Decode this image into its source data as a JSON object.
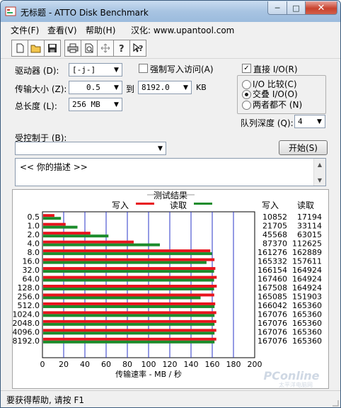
{
  "window": {
    "title": "无标题 - ATTO Disk Benchmark",
    "min": "─",
    "max": "□",
    "close": "✕"
  },
  "menu": [
    "文件(F)",
    "查看(V)",
    "帮助(H)",
    "汉化: www.upantool.com"
  ],
  "toolbar_icons": [
    "new-icon",
    "open-icon",
    "save-icon",
    "print-icon",
    "print-preview-icon",
    "move-icon",
    "help-icon",
    "context-help-icon"
  ],
  "form": {
    "drive_label": "驱动器 (D):",
    "drive_value": "[-j-]",
    "force_write_label": "强制写入访问(A)",
    "transfer_label": "传输大小 (Z):",
    "transfer_from": "0.5",
    "transfer_to_label": "到",
    "transfer_to": "8192.0",
    "transfer_unit": "KB",
    "total_label": "总长度 (L):",
    "total_value": "256 MB",
    "direct_io_label": "直接 I/O(R)",
    "io_compare_label": "I/O 比较(C)",
    "overlapped_io_label": "交叠 I/O(O)",
    "neither_label": "两者都不 (N)",
    "queue_label": "队列深度 (Q):",
    "queue_value": "4",
    "controlled_by_label": "受控制于 (B):",
    "controlled_by_value": "",
    "start_button": "开始(S)",
    "description_text": "<<   你的描述     >>"
  },
  "results": {
    "title": "测试结果",
    "legend_write": "写入",
    "legend_read": "读取",
    "col_write": "写入",
    "col_read": "读取",
    "write_color": "#e8141c",
    "read_color": "#1c8c2c",
    "grid_color": "#2a36c8"
  },
  "chart_data": {
    "type": "bar",
    "orientation": "horizontal",
    "categories": [
      "0.5",
      "1.0",
      "2.0",
      "4.0",
      "8.0",
      "16.0",
      "32.0",
      "64.0",
      "128.0",
      "256.0",
      "512.0",
      "1024.0",
      "2048.0",
      "4096.0",
      "8192.0"
    ],
    "series": [
      {
        "name": "写入",
        "values": [
          10852,
          21705,
          45568,
          87370,
          161276,
          165332,
          166154,
          167460,
          167508,
          165085,
          166042,
          167076,
          167076,
          167076,
          167076
        ]
      },
      {
        "name": "读取",
        "values": [
          17194,
          33114,
          63015,
          112625,
          162889,
          157611,
          164924,
          164924,
          164924,
          151903,
          165360,
          165360,
          165360,
          165360,
          165360
        ]
      }
    ],
    "xticks": [
      "0",
      "20",
      "40",
      "60",
      "80",
      "100",
      "120",
      "140",
      "160",
      "180",
      "200"
    ],
    "xlim": [
      0,
      200
    ],
    "xlabel": "传输速率 - MB / 秒",
    "grid": true,
    "legend_position": "top"
  },
  "status": {
    "text": "要获得帮助, 请按 F1"
  },
  "watermark": {
    "text": "PConline",
    "sub": "太平洋电脑网"
  }
}
